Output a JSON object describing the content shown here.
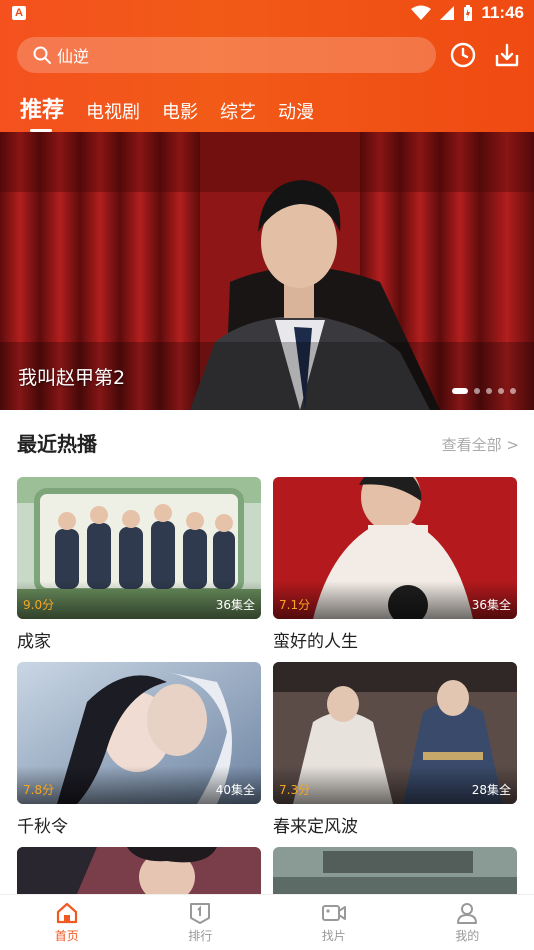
{
  "status_bar": {
    "time": "11:46",
    "app_badge": "A"
  },
  "search": {
    "query": "仙逆"
  },
  "header_icons": {
    "history": "clock-icon",
    "download": "download-icon"
  },
  "tabs": [
    {
      "label": "推荐",
      "active": true
    },
    {
      "label": "电视剧",
      "active": false
    },
    {
      "label": "电影",
      "active": false
    },
    {
      "label": "综艺",
      "active": false
    },
    {
      "label": "动漫",
      "active": false
    }
  ],
  "banner": {
    "title": "我叫赵甲第2",
    "slides": 5,
    "active_slide": 1
  },
  "section": {
    "title": "最近热播",
    "more": "查看全部 >"
  },
  "items": [
    {
      "title": "成家",
      "score": "9.0分",
      "episodes": "36集全"
    },
    {
      "title": "蛮好的人生",
      "score": "7.1分",
      "episodes": "36集全"
    },
    {
      "title": "千秋令",
      "score": "7.8分",
      "episodes": "40集全"
    },
    {
      "title": "春来定风波",
      "score": "7.3分",
      "episodes": "28集全"
    }
  ],
  "nav": [
    {
      "label": "首页",
      "icon": "home-icon",
      "active": true
    },
    {
      "label": "排行",
      "icon": "ranking-icon",
      "active": false
    },
    {
      "label": "找片",
      "icon": "video-camera-icon",
      "active": false
    },
    {
      "label": "我的",
      "icon": "user-icon",
      "active": false
    }
  ],
  "colors": {
    "accent": "#f05a22",
    "header": "#f4511e",
    "score": "#f6a623"
  }
}
